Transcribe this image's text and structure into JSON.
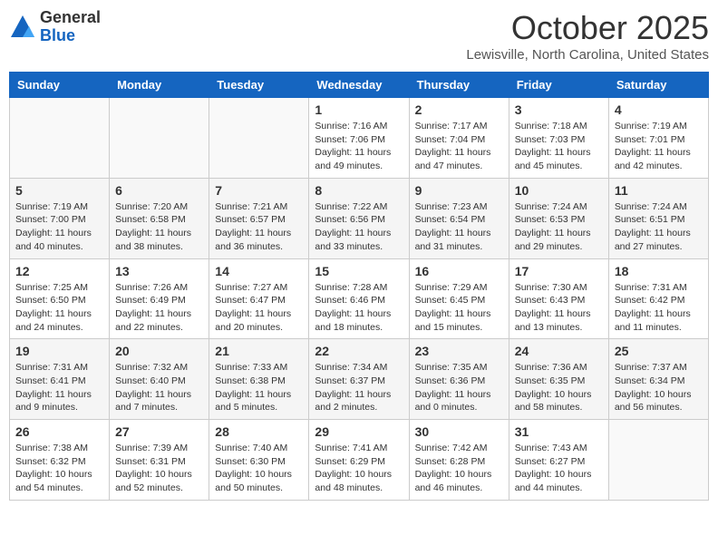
{
  "logo": {
    "general": "General",
    "blue": "Blue"
  },
  "title": "October 2025",
  "location": "Lewisville, North Carolina, United States",
  "headers": [
    "Sunday",
    "Monday",
    "Tuesday",
    "Wednesday",
    "Thursday",
    "Friday",
    "Saturday"
  ],
  "weeks": [
    [
      {
        "day": "",
        "info": ""
      },
      {
        "day": "",
        "info": ""
      },
      {
        "day": "",
        "info": ""
      },
      {
        "day": "1",
        "info": "Sunrise: 7:16 AM\nSunset: 7:06 PM\nDaylight: 11 hours\nand 49 minutes."
      },
      {
        "day": "2",
        "info": "Sunrise: 7:17 AM\nSunset: 7:04 PM\nDaylight: 11 hours\nand 47 minutes."
      },
      {
        "day": "3",
        "info": "Sunrise: 7:18 AM\nSunset: 7:03 PM\nDaylight: 11 hours\nand 45 minutes."
      },
      {
        "day": "4",
        "info": "Sunrise: 7:19 AM\nSunset: 7:01 PM\nDaylight: 11 hours\nand 42 minutes."
      }
    ],
    [
      {
        "day": "5",
        "info": "Sunrise: 7:19 AM\nSunset: 7:00 PM\nDaylight: 11 hours\nand 40 minutes."
      },
      {
        "day": "6",
        "info": "Sunrise: 7:20 AM\nSunset: 6:58 PM\nDaylight: 11 hours\nand 38 minutes."
      },
      {
        "day": "7",
        "info": "Sunrise: 7:21 AM\nSunset: 6:57 PM\nDaylight: 11 hours\nand 36 minutes."
      },
      {
        "day": "8",
        "info": "Sunrise: 7:22 AM\nSunset: 6:56 PM\nDaylight: 11 hours\nand 33 minutes."
      },
      {
        "day": "9",
        "info": "Sunrise: 7:23 AM\nSunset: 6:54 PM\nDaylight: 11 hours\nand 31 minutes."
      },
      {
        "day": "10",
        "info": "Sunrise: 7:24 AM\nSunset: 6:53 PM\nDaylight: 11 hours\nand 29 minutes."
      },
      {
        "day": "11",
        "info": "Sunrise: 7:24 AM\nSunset: 6:51 PM\nDaylight: 11 hours\nand 27 minutes."
      }
    ],
    [
      {
        "day": "12",
        "info": "Sunrise: 7:25 AM\nSunset: 6:50 PM\nDaylight: 11 hours\nand 24 minutes."
      },
      {
        "day": "13",
        "info": "Sunrise: 7:26 AM\nSunset: 6:49 PM\nDaylight: 11 hours\nand 22 minutes."
      },
      {
        "day": "14",
        "info": "Sunrise: 7:27 AM\nSunset: 6:47 PM\nDaylight: 11 hours\nand 20 minutes."
      },
      {
        "day": "15",
        "info": "Sunrise: 7:28 AM\nSunset: 6:46 PM\nDaylight: 11 hours\nand 18 minutes."
      },
      {
        "day": "16",
        "info": "Sunrise: 7:29 AM\nSunset: 6:45 PM\nDaylight: 11 hours\nand 15 minutes."
      },
      {
        "day": "17",
        "info": "Sunrise: 7:30 AM\nSunset: 6:43 PM\nDaylight: 11 hours\nand 13 minutes."
      },
      {
        "day": "18",
        "info": "Sunrise: 7:31 AM\nSunset: 6:42 PM\nDaylight: 11 hours\nand 11 minutes."
      }
    ],
    [
      {
        "day": "19",
        "info": "Sunrise: 7:31 AM\nSunset: 6:41 PM\nDaylight: 11 hours\nand 9 minutes."
      },
      {
        "day": "20",
        "info": "Sunrise: 7:32 AM\nSunset: 6:40 PM\nDaylight: 11 hours\nand 7 minutes."
      },
      {
        "day": "21",
        "info": "Sunrise: 7:33 AM\nSunset: 6:38 PM\nDaylight: 11 hours\nand 5 minutes."
      },
      {
        "day": "22",
        "info": "Sunrise: 7:34 AM\nSunset: 6:37 PM\nDaylight: 11 hours\nand 2 minutes."
      },
      {
        "day": "23",
        "info": "Sunrise: 7:35 AM\nSunset: 6:36 PM\nDaylight: 11 hours\nand 0 minutes."
      },
      {
        "day": "24",
        "info": "Sunrise: 7:36 AM\nSunset: 6:35 PM\nDaylight: 10 hours\nand 58 minutes."
      },
      {
        "day": "25",
        "info": "Sunrise: 7:37 AM\nSunset: 6:34 PM\nDaylight: 10 hours\nand 56 minutes."
      }
    ],
    [
      {
        "day": "26",
        "info": "Sunrise: 7:38 AM\nSunset: 6:32 PM\nDaylight: 10 hours\nand 54 minutes."
      },
      {
        "day": "27",
        "info": "Sunrise: 7:39 AM\nSunset: 6:31 PM\nDaylight: 10 hours\nand 52 minutes."
      },
      {
        "day": "28",
        "info": "Sunrise: 7:40 AM\nSunset: 6:30 PM\nDaylight: 10 hours\nand 50 minutes."
      },
      {
        "day": "29",
        "info": "Sunrise: 7:41 AM\nSunset: 6:29 PM\nDaylight: 10 hours\nand 48 minutes."
      },
      {
        "day": "30",
        "info": "Sunrise: 7:42 AM\nSunset: 6:28 PM\nDaylight: 10 hours\nand 46 minutes."
      },
      {
        "day": "31",
        "info": "Sunrise: 7:43 AM\nSunset: 6:27 PM\nDaylight: 10 hours\nand 44 minutes."
      },
      {
        "day": "",
        "info": ""
      }
    ]
  ]
}
